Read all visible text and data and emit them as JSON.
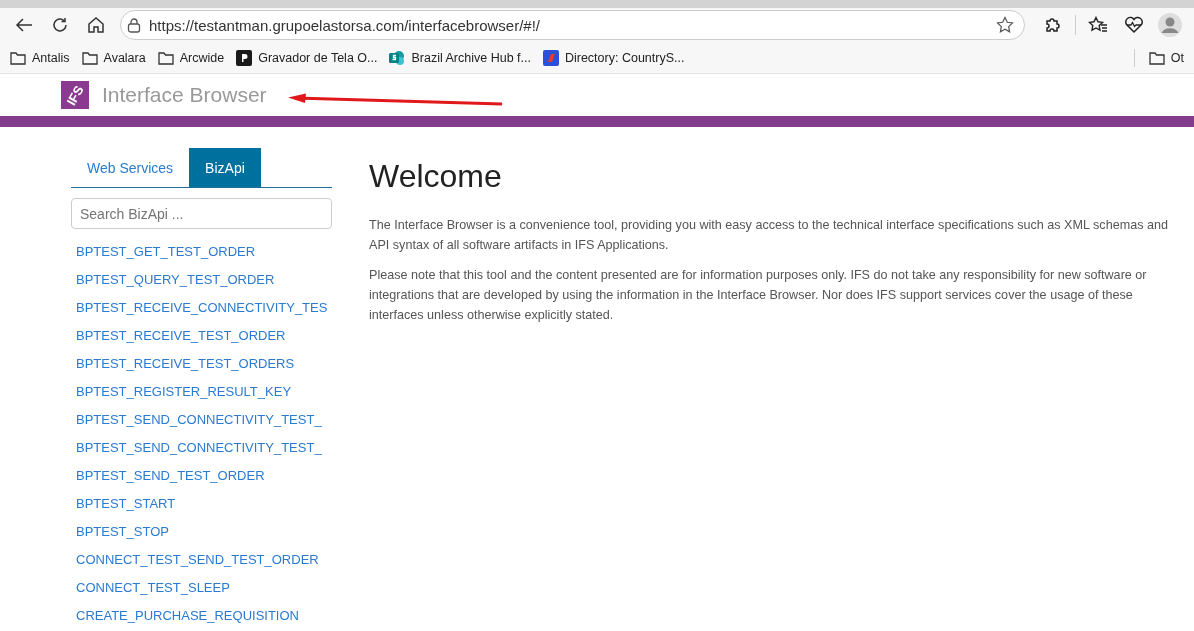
{
  "browser": {
    "url": "https://testantman.grupoelastorsa.com/interfacebrowser/#!/",
    "bookmarks": [
      {
        "label": "Antalis",
        "kind": "folder"
      },
      {
        "label": "Avalara",
        "kind": "folder"
      },
      {
        "label": "Arcwide",
        "kind": "folder"
      },
      {
        "label": "Gravador de Tela O...",
        "kind": "dark"
      },
      {
        "label": "Brazil Archive Hub f...",
        "kind": "sharepoint"
      },
      {
        "label": "Directory: CountryS...",
        "kind": "directory"
      }
    ],
    "other_bookmarks": "Ot"
  },
  "header": {
    "logo_text": "IFS",
    "title": "Interface Browser"
  },
  "sidebar": {
    "tabs": [
      {
        "label": "Web Services",
        "selected": false
      },
      {
        "label": "BizApi",
        "selected": true
      }
    ],
    "search": {
      "placeholder": "Search BizApi ..."
    },
    "items": [
      "BPTEST_GET_TEST_ORDER",
      "BPTEST_QUERY_TEST_ORDER",
      "BPTEST_RECEIVE_CONNECTIVITY_TES",
      "BPTEST_RECEIVE_TEST_ORDER",
      "BPTEST_RECEIVE_TEST_ORDERS",
      "BPTEST_REGISTER_RESULT_KEY",
      "BPTEST_SEND_CONNECTIVITY_TEST_",
      "BPTEST_SEND_CONNECTIVITY_TEST_",
      "BPTEST_SEND_TEST_ORDER",
      "BPTEST_START",
      "BPTEST_STOP",
      "CONNECT_TEST_SEND_TEST_ORDER",
      "CONNECT_TEST_SLEEP",
      "CREATE_PURCHASE_REQUISITION"
    ]
  },
  "content": {
    "heading": "Welcome",
    "paragraphs": [
      "The Interface Browser is a convenience tool, providing you with easy access to the technical interface specifications such as XML schemas and API syntax of all software artifacts in IFS Applications.",
      "Please note that this tool and the content presented are for information purposes only. IFS do not take any responsibility for new software or integrations that are developed by using the information in the Interface Browser. Nor does IFS support services cover the usage of these interfaces unless otherwise explicitly stated."
    ]
  }
}
